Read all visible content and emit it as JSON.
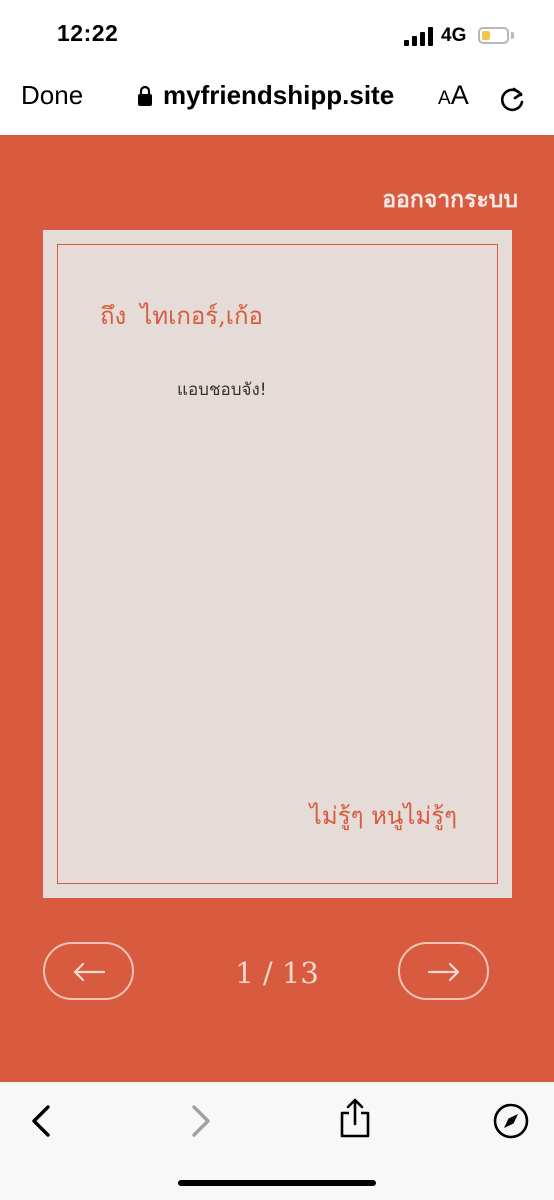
{
  "status_bar": {
    "time": "12:22",
    "network": "4G",
    "battery_level": 0.35,
    "battery_color": "#f2c744"
  },
  "browser": {
    "done_label": "Done",
    "url": "myfriendshipp.site",
    "text_size_small": "A",
    "text_size_large": "A",
    "icons": [
      "lock-icon",
      "reload-icon"
    ]
  },
  "page": {
    "logout_label": "ออกจากระบบ",
    "letter": {
      "to_prefix": "ถึง",
      "recipient": "ไทเกอร์,เก้อ",
      "body": "แอบชอบจัง!",
      "from": "ไม่รู้ๆ หนูไม่รู้ๆ"
    },
    "pagination": {
      "current": 1,
      "total": 13,
      "indicator": "1 / 13",
      "prev_icon": "arrow-left-icon",
      "next_icon": "arrow-right-icon"
    },
    "colors": {
      "background": "#d85b40",
      "card": "#e5dcd7",
      "accent_text": "#d85b40"
    }
  },
  "toolbar": {
    "icons": [
      "back-chevron-icon",
      "forward-chevron-icon",
      "share-icon",
      "compass-icon"
    ]
  }
}
